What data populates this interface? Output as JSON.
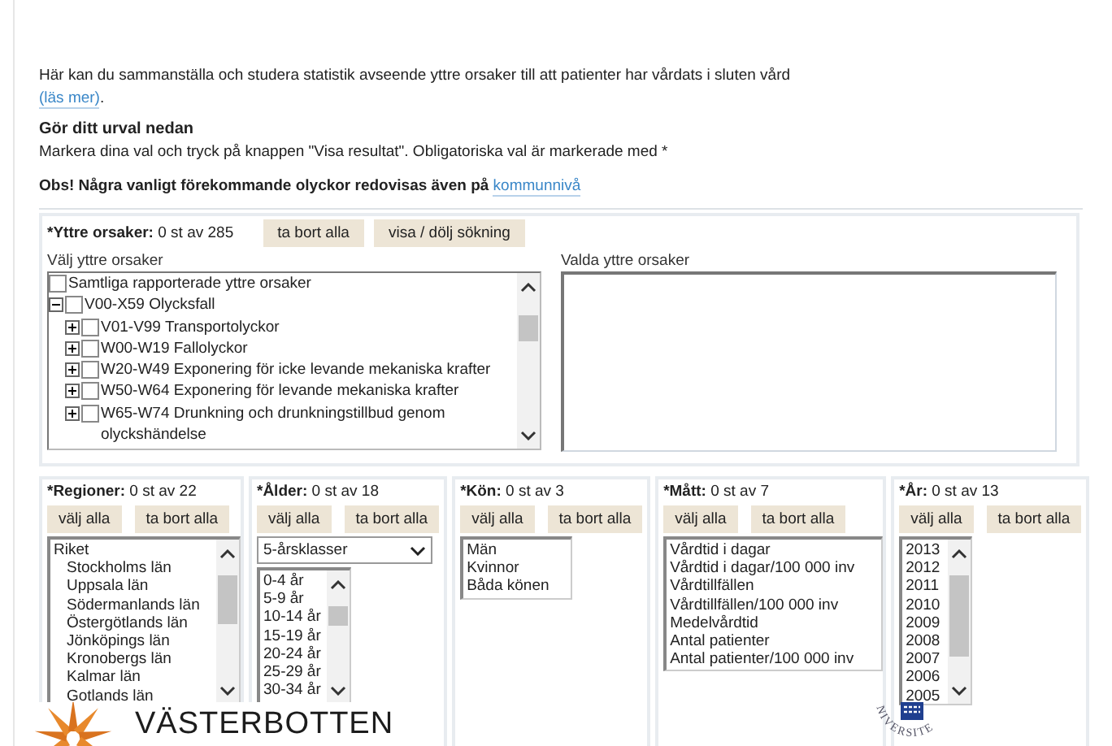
{
  "intro": {
    "text": "Här kan du sammanställa och studera statistik avseende yttre orsaker till att patienter har vårdats i sluten vård",
    "link": "(läs mer)",
    "after_link": "."
  },
  "heading": "Gör ditt urval nedan",
  "instruction": "Markera dina val och tryck på knappen \"Visa resultat\". Obligatoriska val är markerade med *",
  "notice": {
    "text": "Obs! Några vanligt förekommande olyckor redovisas även på",
    "link": "kommunnivå"
  },
  "causes": {
    "label": "*Yttre orsaker:",
    "count": "0 st av 285",
    "buttons": [
      "ta bort alla",
      "visa / dölj sökning"
    ],
    "list_label": "Välj yttre orsaker",
    "selected_label": "Valda yttre orsaker",
    "tree": [
      {
        "label": "Samtliga rapporterade yttre orsaker",
        "checked": false
      },
      {
        "label": "V00-X59 Olycksfall",
        "checked": false,
        "expanded": true,
        "children": [
          {
            "label": "V01-V99 Transportolyckor",
            "checked": false,
            "expanded": false
          },
          {
            "label": "W00-W19 Fallolyckor",
            "checked": false,
            "expanded": false
          },
          {
            "label": "W20-W49 Exponering för icke levande mekaniska krafter",
            "checked": false,
            "expanded": false
          },
          {
            "label": "W50-W64 Exponering för levande mekaniska krafter",
            "checked": false,
            "expanded": false
          },
          {
            "label": "W65-W74 Drunkning och drunkningstillbud genom olyckshändelse",
            "checked": false,
            "expanded": false
          }
        ]
      }
    ]
  },
  "filters": [
    {
      "kind": "list",
      "label": "*Regioner:",
      "count": "0 st av 22",
      "buttons": [
        "välj alla",
        "ta bort alla"
      ],
      "options": [
        {
          "label": "Riket",
          "children": [
            {
              "label": "Stockholms län"
            },
            {
              "label": "Uppsala län"
            },
            {
              "label": "Södermanlands län"
            },
            {
              "label": "Östergötlands län"
            },
            {
              "label": "Jönköpings län"
            },
            {
              "label": "Kronobergs län"
            },
            {
              "label": "Kalmar län"
            },
            {
              "label": "Gotlands län"
            }
          ]
        }
      ]
    },
    {
      "kind": "dropdown",
      "label": "*Ålder:",
      "count": "0 st av 18",
      "buttons": [
        "välj alla",
        "ta bort alla"
      ],
      "dropdown": "5-årsklasser",
      "options": [
        {
          "label": "0-4 år"
        },
        {
          "label": "5-9 år"
        },
        {
          "label": "10-14 år"
        },
        {
          "label": "15-19 år"
        },
        {
          "label": "20-24 år"
        },
        {
          "label": "25-29 år"
        },
        {
          "label": "30-34 år"
        }
      ]
    },
    {
      "kind": "list",
      "label": "*Kön:",
      "count": "0 st av 3",
      "buttons": [
        "välj alla",
        "ta bort alla"
      ],
      "options": [
        {
          "label": "Män"
        },
        {
          "label": "Kvinnor"
        },
        {
          "label": "Båda könen"
        }
      ]
    },
    {
      "kind": "list",
      "label": "*Mått:",
      "count": "0 st av 7",
      "buttons": [
        "välj alla",
        "ta bort alla"
      ],
      "options": [
        {
          "label": "Vårdtid i dagar"
        },
        {
          "label": "Vårdtid i dagar/100 000 inv"
        },
        {
          "label": "Vårdtillfällen"
        },
        {
          "label": "Vårdtillfällen/100 000 inv"
        },
        {
          "label": "Medelvårdtid"
        },
        {
          "label": "Antal patienter"
        },
        {
          "label": "Antal patienter/100 000 inv"
        }
      ]
    },
    {
      "kind": "list",
      "label": "*År:",
      "count": "0 st av 13",
      "buttons": [
        "välj alla",
        "ta bort alla"
      ],
      "options": [
        {
          "label": "2013"
        },
        {
          "label": "2012"
        },
        {
          "label": "2011"
        },
        {
          "label": "2010"
        },
        {
          "label": "2009"
        },
        {
          "label": "2008"
        },
        {
          "label": "2007"
        },
        {
          "label": "2006"
        },
        {
          "label": "2005"
        }
      ]
    }
  ],
  "logo": {
    "text": "VÄSTERBOTTEN"
  },
  "seal": {
    "text": "NIVERSITE"
  }
}
